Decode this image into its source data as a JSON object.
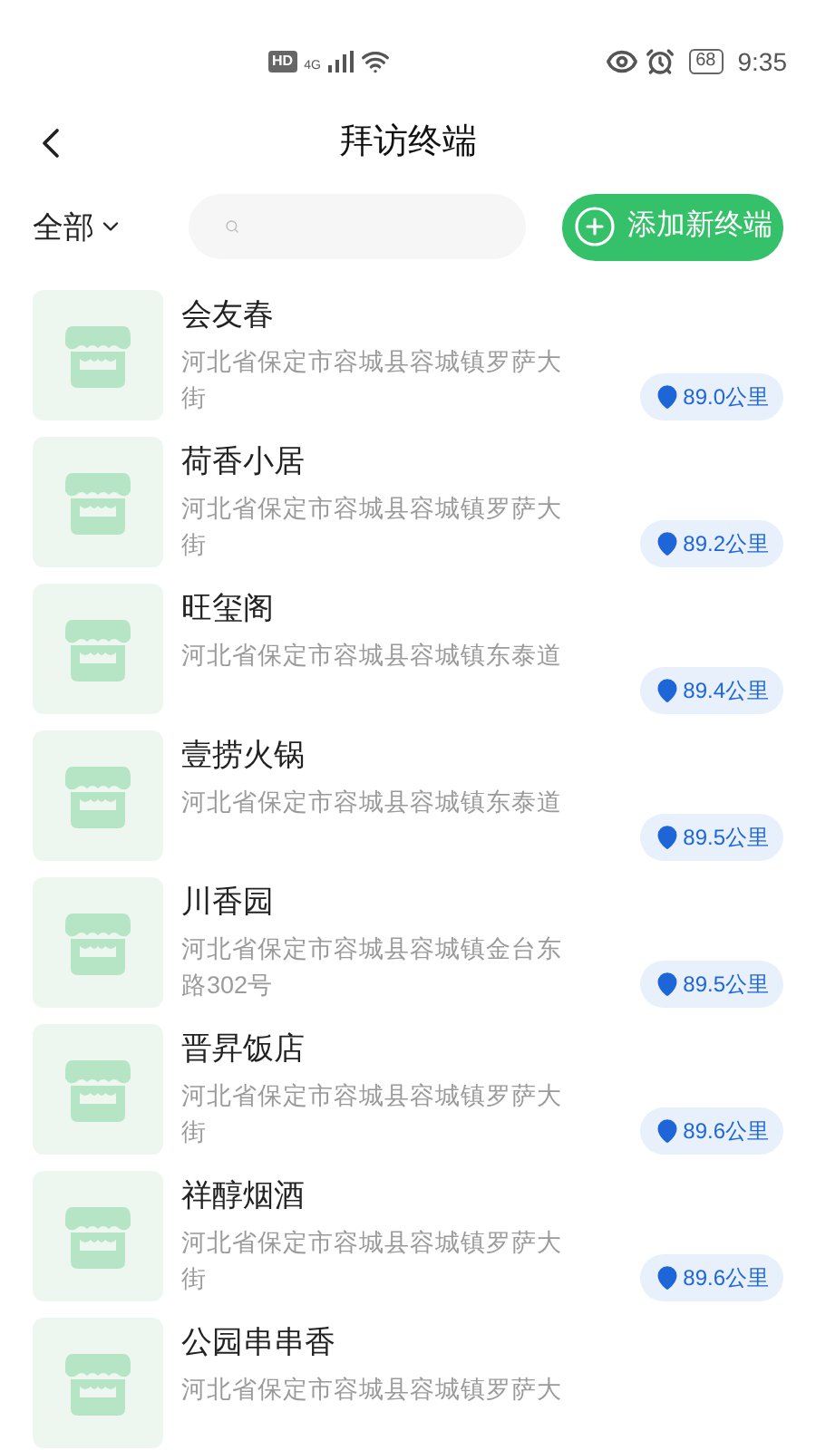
{
  "status_bar": {
    "hd": "HD",
    "network": "4G",
    "battery": "68",
    "time": "9:35"
  },
  "header": {
    "title": "拜访终端"
  },
  "toolbar": {
    "filter": "全部",
    "add_button": "添加新终端"
  },
  "terminals": [
    {
      "name": "会友春",
      "address": "河北省保定市容城县容城镇罗萨大街",
      "distance": "89.0公里"
    },
    {
      "name": "荷香小居",
      "address": "河北省保定市容城县容城镇罗萨大街",
      "distance": "89.2公里"
    },
    {
      "name": "旺玺阁",
      "address": "河北省保定市容城县容城镇东泰道",
      "distance": "89.4公里"
    },
    {
      "name": "壹捞火锅",
      "address": "河北省保定市容城县容城镇东泰道",
      "distance": "89.5公里"
    },
    {
      "name": "川香园",
      "address": "河北省保定市容城县容城镇金台东路302号",
      "distance": "89.5公里"
    },
    {
      "name": "晋昇饭店",
      "address": "河北省保定市容城县容城镇罗萨大街",
      "distance": "89.6公里"
    },
    {
      "name": "祥醇烟酒",
      "address": "河北省保定市容城县容城镇罗萨大街",
      "distance": "89.6公里"
    },
    {
      "name": "公园串串香",
      "address": "河北省保定市容城县容城镇罗萨大"
    }
  ]
}
